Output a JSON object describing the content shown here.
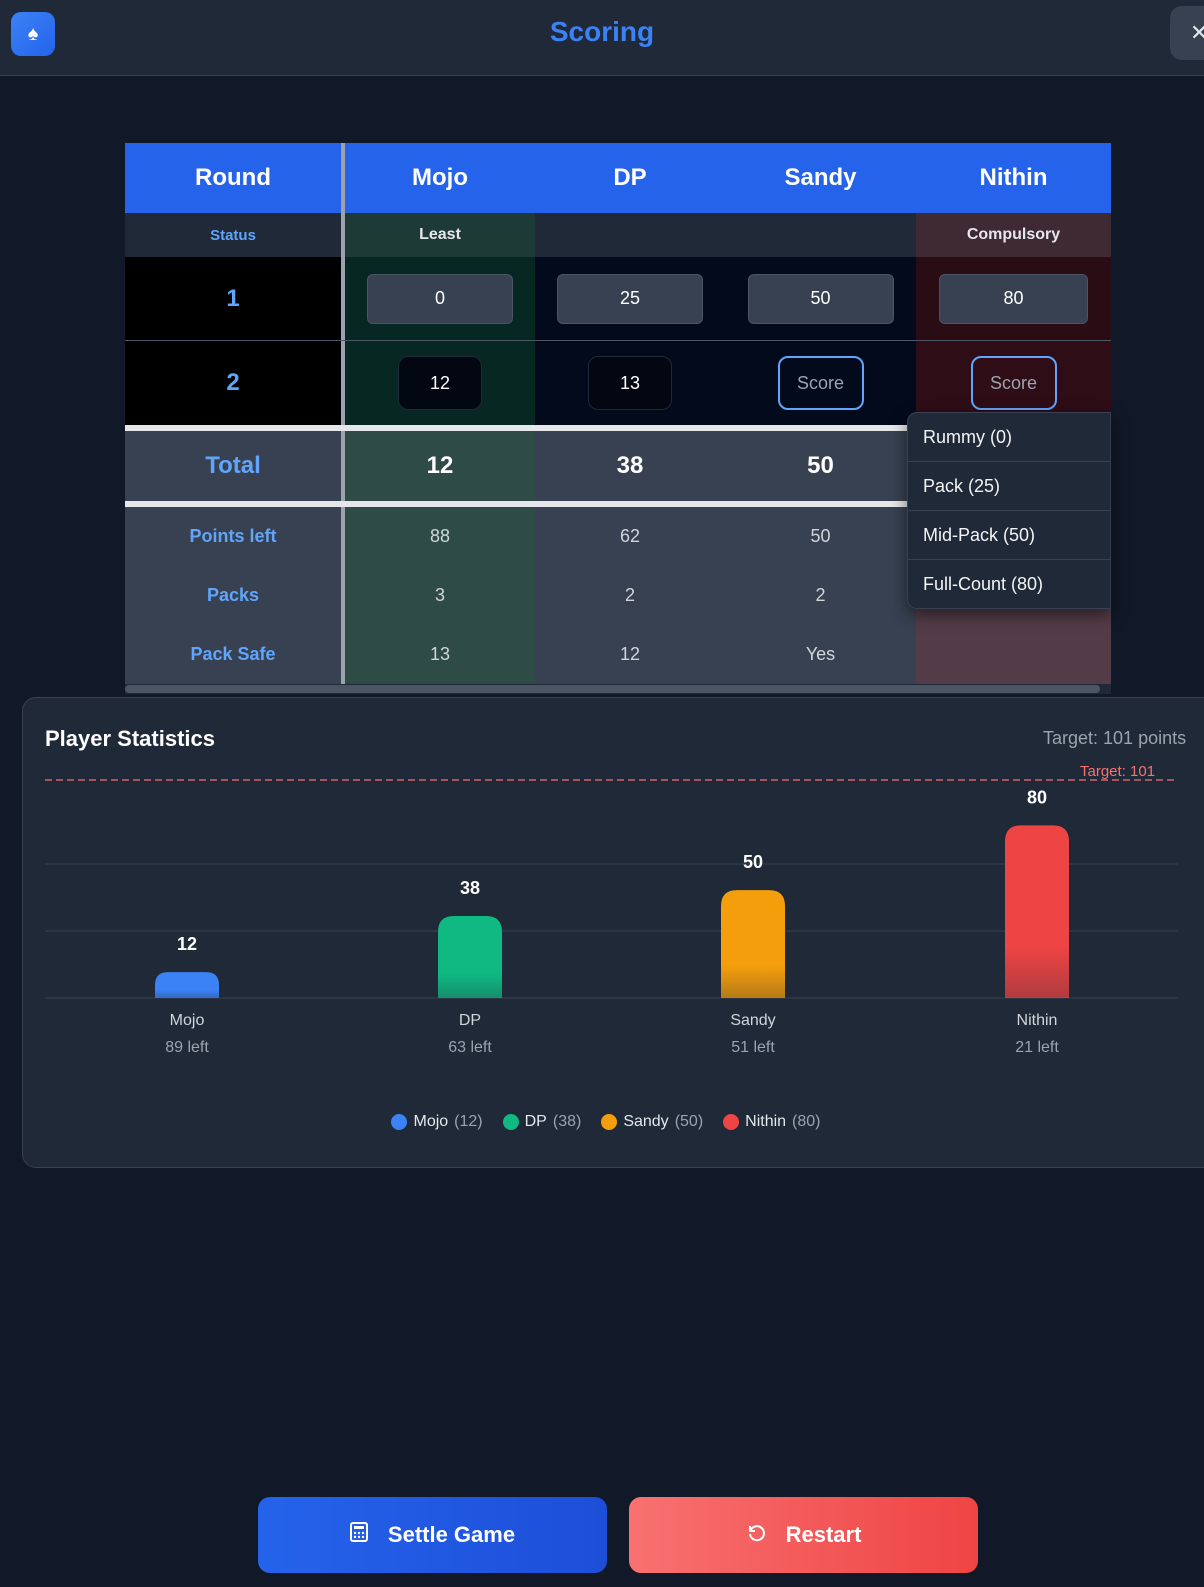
{
  "header": {
    "title": "Scoring",
    "logo_icon": "spade-icon",
    "close_icon": "close-icon",
    "close_glyph": "✕"
  },
  "table": {
    "headers": [
      "Round",
      "Mojo",
      "DP",
      "Sandy",
      "Nithin"
    ],
    "status_label": "Status",
    "status": [
      "Least",
      "",
      "",
      "Compulsory"
    ],
    "rounds": [
      {
        "label": "1",
        "scores": [
          "0",
          "25",
          "50",
          "80"
        ]
      },
      {
        "label": "2",
        "scores": [
          "12",
          "13",
          "Score",
          "Score"
        ]
      }
    ],
    "total_label": "Total",
    "totals": [
      "12",
      "38",
      "50",
      ""
    ],
    "stats": [
      {
        "label": "Points left",
        "values": [
          "88",
          "62",
          "50",
          ""
        ]
      },
      {
        "label": "Packs",
        "values": [
          "3",
          "2",
          "2",
          ""
        ]
      },
      {
        "label": "Pack Safe",
        "values": [
          "13",
          "12",
          "Yes",
          ""
        ]
      }
    ]
  },
  "dropdown": {
    "options": [
      "Rummy (0)",
      "Pack (25)",
      "Mid-Pack (50)",
      "Full-Count (80)"
    ]
  },
  "stats_panel": {
    "title": "Player Statistics",
    "target_text": "Target: 101 points",
    "target_line_label": "Target: 101"
  },
  "chart_data": {
    "type": "bar",
    "categories": [
      "Mojo",
      "DP",
      "Sandy",
      "Nithin"
    ],
    "values": [
      12,
      38,
      50,
      80
    ],
    "left_labels": [
      "89 left",
      "63 left",
      "51 left",
      "21 left"
    ],
    "colors": [
      "#3b82f6",
      "#10b981",
      "#f59e0b",
      "#ef4444"
    ],
    "target": 101,
    "legend": [
      {
        "name": "Mojo",
        "value": "(12)"
      },
      {
        "name": "DP",
        "value": "(38)"
      },
      {
        "name": "Sandy",
        "value": "(50)"
      },
      {
        "name": "Nithin",
        "value": "(80)"
      }
    ]
  },
  "buttons": {
    "settle": "Settle Game",
    "restart": "Restart",
    "settle_icon": "calculator-icon",
    "restart_icon": "restart-icon"
  }
}
